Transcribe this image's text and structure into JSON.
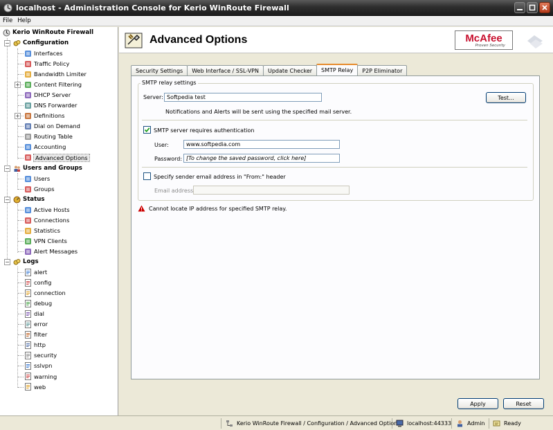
{
  "window": {
    "title": "localhost - Administration Console for Kerio WinRoute Firewall"
  },
  "menu": [
    "File",
    "Help"
  ],
  "tree": {
    "root": "Kerio WinRoute Firewall",
    "configuration": "Configuration",
    "config_items": [
      "Interfaces",
      "Traffic Policy",
      "Bandwidth Limiter",
      "Content Filtering",
      "DHCP Server",
      "DNS Forwarder",
      "Definitions",
      "Dial on Demand",
      "Routing Table",
      "Accounting",
      "Advanced Options"
    ],
    "users_groups": "Users and Groups",
    "ug_items": [
      "Users",
      "Groups"
    ],
    "status": "Status",
    "status_items": [
      "Active Hosts",
      "Connections",
      "Statistics",
      "VPN Clients",
      "Alert Messages"
    ],
    "logs": "Logs",
    "log_items": [
      "alert",
      "config",
      "connection",
      "debug",
      "dial",
      "error",
      "filter",
      "http",
      "security",
      "sslvpn",
      "warning",
      "web"
    ]
  },
  "header": {
    "title": "Advanced Options",
    "brand": "McAfee",
    "brand_tag": "Proven Security"
  },
  "tabs": [
    "Security Settings",
    "Web Interface / SSL-VPN",
    "Update Checker",
    "SMTP Relay",
    "P2P Eliminator"
  ],
  "smtp": {
    "group_label": "SMTP relay settings",
    "server_label": "Server:",
    "server_value": "Softpedia test",
    "test_button": "Test...",
    "notice": "Notifications and Alerts will be sent using the specified mail server.",
    "auth_label": "SMTP server requires authentication",
    "auth_checked": true,
    "user_label": "User:",
    "user_value": "www.softpedia.com",
    "password_label": "Password:",
    "password_value": "[To change the saved password, click here]",
    "sender_label": "Specify sender email address in \"From:\" header",
    "sender_checked": false,
    "email_label": "Email address:",
    "email_value": "",
    "warning": "Cannot locate IP address for specified SMTP relay."
  },
  "buttons": {
    "apply": "Apply",
    "reset": "Reset"
  },
  "statusbar": {
    "path": "Kerio WinRoute Firewall / Configuration / Advanced Options",
    "server": "localhost:44333",
    "user": "Admin",
    "state": "Ready"
  },
  "colors": {
    "accent_tab": "#e68b2c",
    "brand_red": "#c8102e",
    "titlebar": "#2e2e2e",
    "warning": "#cc0000"
  }
}
